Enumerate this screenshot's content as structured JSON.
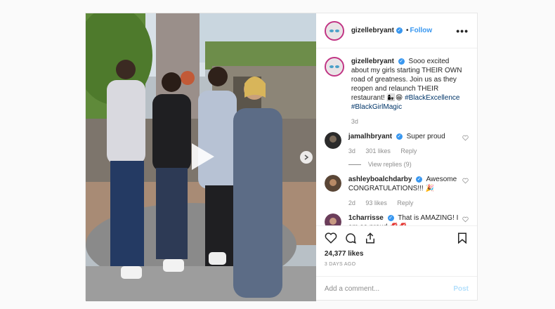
{
  "post": {
    "author": "gizelleb ryant",
    "follow_label": "Follow",
    "more_label": "•••",
    "caption": {
      "username": "gizellebryant",
      "text": "Sooo excited about my girls starting THEIR OWN road of greatness. Join us as they reopen and relaunch THEIR restaurant! 👩‍👧😁",
      "hashtags": "#BlackExcellence #BlackGirlMagic",
      "time": "3d"
    },
    "comments": [
      {
        "username": "jamalhbryant",
        "verified": true,
        "text": "Super proud",
        "time": "3d",
        "likes": "301 likes",
        "reply": "Reply",
        "view_replies": "View replies (9)"
      },
      {
        "username": "ashleyboalchdarby",
        "verified": true,
        "text": "Awesome CONGRATULATIONS!!! 🎉",
        "time": "2d",
        "likes": "93 likes",
        "reply": "Reply"
      },
      {
        "username": "1charrisse",
        "verified": true,
        "text": "That is AMAZING! I am so proud 💋💋",
        "time": "",
        "likes": "",
        "reply": ""
      }
    ],
    "likes_count": "24,377 likes",
    "date": "3 DAYS AGO",
    "add_comment_placeholder": "Add a comment...",
    "post_button": "Post",
    "colors": {
      "accent": "#3897f0",
      "text": "#262626",
      "muted": "#8e8e8e"
    }
  }
}
